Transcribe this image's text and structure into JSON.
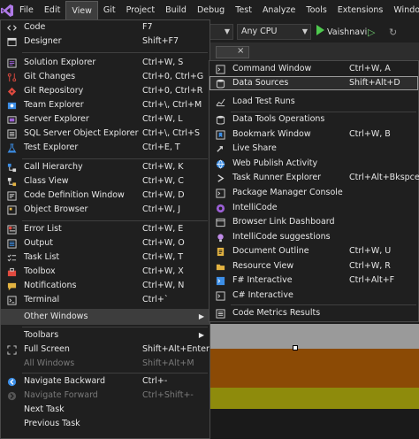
{
  "menubar": {
    "items": [
      "File",
      "Edit",
      "View",
      "Git",
      "Project",
      "Build",
      "Debug",
      "Test",
      "Analyze",
      "Tools",
      "Extensions",
      "Window"
    ]
  },
  "toolbar": {
    "platform": "Any CPU",
    "run_target": "Vaishnavi"
  },
  "view_menu": [
    {
      "label": "Code",
      "shortcut": "F7",
      "icon": "code-icon"
    },
    {
      "label": "Designer",
      "shortcut": "Shift+F7",
      "icon": "designer-icon"
    },
    {
      "label": "Solution Explorer",
      "shortcut": "Ctrl+W, S",
      "icon": "solution-explorer-icon"
    },
    {
      "label": "Git Changes",
      "shortcut": "Ctrl+0, Ctrl+G",
      "icon": "git-changes-icon"
    },
    {
      "label": "Git Repository",
      "shortcut": "Ctrl+0, Ctrl+R",
      "icon": "git-repository-icon"
    },
    {
      "label": "Team Explorer",
      "shortcut": "Ctrl+\\, Ctrl+M",
      "icon": "team-explorer-icon"
    },
    {
      "label": "Server Explorer",
      "shortcut": "Ctrl+W, L",
      "icon": "server-explorer-icon"
    },
    {
      "label": "SQL Server Object Explorer",
      "shortcut": "Ctrl+\\, Ctrl+S",
      "icon": "sql-server-icon"
    },
    {
      "label": "Test Explorer",
      "shortcut": "Ctrl+E, T",
      "icon": "test-explorer-icon"
    },
    {
      "label": "Call Hierarchy",
      "shortcut": "Ctrl+W, K",
      "icon": "call-hierarchy-icon"
    },
    {
      "label": "Class View",
      "shortcut": "Ctrl+W, C",
      "icon": "class-view-icon"
    },
    {
      "label": "Code Definition Window",
      "shortcut": "Ctrl+W, D",
      "icon": "code-definition-icon"
    },
    {
      "label": "Object Browser",
      "shortcut": "Ctrl+W, J",
      "icon": "object-browser-icon"
    },
    {
      "label": "Error List",
      "shortcut": "Ctrl+W, E",
      "icon": "error-list-icon"
    },
    {
      "label": "Output",
      "shortcut": "Ctrl+W, O",
      "icon": "output-icon"
    },
    {
      "label": "Task List",
      "shortcut": "Ctrl+W, T",
      "icon": "task-list-icon"
    },
    {
      "label": "Toolbox",
      "shortcut": "Ctrl+W, X",
      "icon": "toolbox-icon"
    },
    {
      "label": "Notifications",
      "shortcut": "Ctrl+W, N",
      "icon": "notifications-icon"
    },
    {
      "label": "Terminal",
      "shortcut": "Ctrl+`",
      "icon": "terminal-icon"
    },
    {
      "label": "Other Windows",
      "shortcut": "",
      "icon": ""
    },
    {
      "label": "Toolbars",
      "shortcut": "",
      "icon": ""
    },
    {
      "label": "Full Screen",
      "shortcut": "Shift+Alt+Enter",
      "icon": "full-screen-icon"
    },
    {
      "label": "All Windows",
      "shortcut": "Shift+Alt+M",
      "icon": ""
    },
    {
      "label": "Navigate Backward",
      "shortcut": "Ctrl+-",
      "icon": "navigate-backward-icon"
    },
    {
      "label": "Navigate Forward",
      "shortcut": "Ctrl+Shift+-",
      "icon": "navigate-forward-icon"
    },
    {
      "label": "Next Task",
      "shortcut": "",
      "icon": ""
    },
    {
      "label": "Previous Task",
      "shortcut": "",
      "icon": ""
    }
  ],
  "other_windows_menu": [
    {
      "label": "Command Window",
      "shortcut": "Ctrl+W, A",
      "icon": "command-window-icon"
    },
    {
      "label": "Data Sources",
      "shortcut": "Shift+Alt+D",
      "icon": "data-sources-icon"
    },
    {
      "label": "Load Test Runs",
      "shortcut": "",
      "icon": "load-test-icon"
    },
    {
      "label": "Data Tools Operations",
      "shortcut": "",
      "icon": "data-tools-icon"
    },
    {
      "label": "Bookmark Window",
      "shortcut": "Ctrl+W, B",
      "icon": "bookmark-icon"
    },
    {
      "label": "Live Share",
      "shortcut": "",
      "icon": "live-share-icon"
    },
    {
      "label": "Web Publish Activity",
      "shortcut": "",
      "icon": "web-publish-icon"
    },
    {
      "label": "Task Runner Explorer",
      "shortcut": "Ctrl+Alt+Bkspce",
      "icon": "task-runner-icon"
    },
    {
      "label": "Package Manager Console",
      "shortcut": "",
      "icon": "package-manager-icon"
    },
    {
      "label": "IntelliCode",
      "shortcut": "",
      "icon": "intellicode-icon"
    },
    {
      "label": "Browser Link Dashboard",
      "shortcut": "",
      "icon": "browser-link-icon"
    },
    {
      "label": "IntelliCode suggestions",
      "shortcut": "",
      "icon": "intellicode-suggestions-icon"
    },
    {
      "label": "Document Outline",
      "shortcut": "Ctrl+W, U",
      "icon": "document-outline-icon"
    },
    {
      "label": "Resource View",
      "shortcut": "Ctrl+W, R",
      "icon": "resource-view-icon"
    },
    {
      "label": "F# Interactive",
      "shortcut": "Ctrl+Alt+F",
      "icon": "fsharp-icon"
    },
    {
      "label": "C# Interactive",
      "shortcut": "",
      "icon": "csharp-icon"
    },
    {
      "label": "Code Metrics Results",
      "shortcut": "",
      "icon": "code-metrics-icon"
    }
  ],
  "colors": {
    "menu_bg": "#1f1f1f",
    "highlight": "#3d3d3d",
    "accent_purple": "#9c5fd6",
    "accent_blue": "#3c8ee6",
    "accent_green": "#4ec94e",
    "accent_red": "#e04a3f",
    "accent_yellow": "#e3b341"
  }
}
